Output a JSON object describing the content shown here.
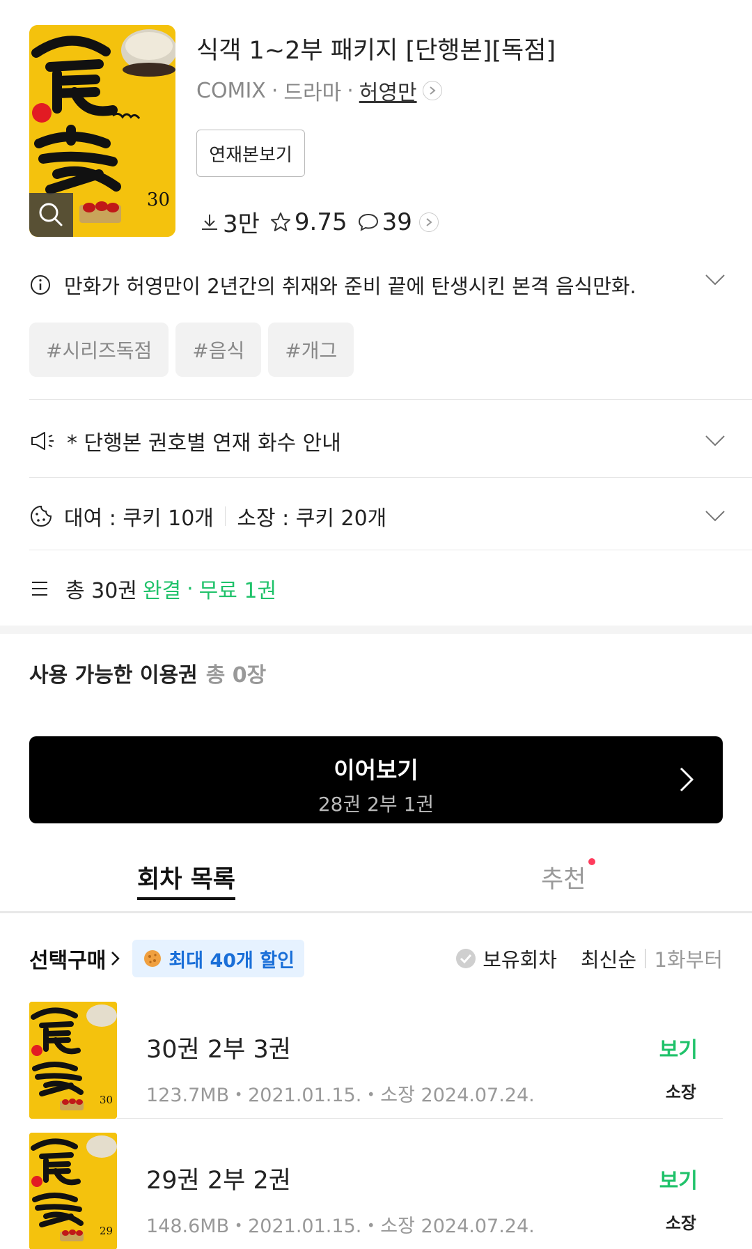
{
  "work": {
    "title": "식객 1~2부 패키지 [단행본][독점]",
    "publisher": "COMIX",
    "genre": "드라마",
    "author": "허영만",
    "serial_button": "연재본보기",
    "cover_volume": "30",
    "downloads": "3만",
    "rating": "9.75",
    "comments": "39"
  },
  "description": "만화가 허영만이 2년간의 취재와 준비 끝에 탄생시킨 본격 음식만화.",
  "tags": [
    "#시리즈독점",
    "#음식",
    "#개그"
  ],
  "notice": "* 단행본 권호별 연재 화수 안내",
  "pricing": {
    "rent": "대여 : 쿠키 10개",
    "own": "소장 : 쿠키 20개"
  },
  "volumes": {
    "total": "총 30권",
    "status": "완결",
    "free": "무료 1권"
  },
  "ticket": {
    "label": "사용 가능한 이용권",
    "count": "총 0장"
  },
  "continue": {
    "label": "이어보기",
    "sub": "28권 2부 1권"
  },
  "tabs": {
    "episodes": "회차 목록",
    "recommend": "추천"
  },
  "list_header": {
    "select_buy": "선택구매",
    "discount": "최대 40개 할인",
    "owned": "보유회차",
    "sort": "최신순",
    "from_first": "1화부터"
  },
  "episodes": [
    {
      "title": "30권 2부 3권",
      "meta": "123.7MB・2021.01.15.・소장 2024.07.24.",
      "view": "보기",
      "status": "소장",
      "cover_volume": "30"
    },
    {
      "title": "29권 2부 2권",
      "meta": "148.6MB・2021.01.15.・소장 2024.07.24.",
      "view": "보기",
      "status": "소장",
      "cover_volume": "29"
    }
  ],
  "colors": {
    "accent_green": "#1fc26a",
    "discount_blue": "#1a6fd8",
    "cover_yellow": "#f4c20d"
  }
}
